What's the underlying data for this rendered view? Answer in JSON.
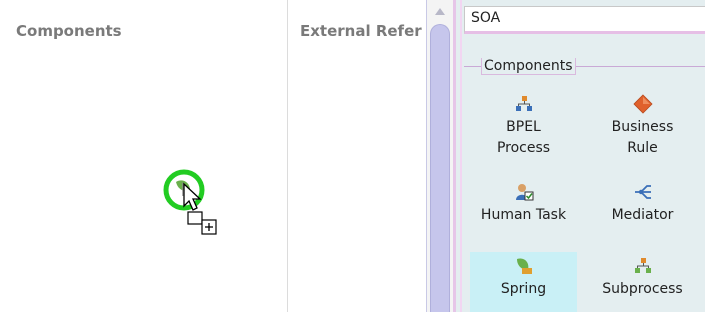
{
  "canvas": {
    "components_title": "Components",
    "external_refs_title": "External Refer"
  },
  "palette": {
    "selected_category": "SOA",
    "section_label": "Components",
    "items": [
      {
        "label_line1": "BPEL",
        "label_line2": "Process",
        "icon": "bpel-process-icon"
      },
      {
        "label_line1": "Business",
        "label_line2": "Rule",
        "icon": "business-rule-icon"
      },
      {
        "label_line1": "Human Task",
        "label_line2": "",
        "icon": "human-task-icon"
      },
      {
        "label_line1": "Mediator",
        "label_line2": "",
        "icon": "mediator-icon"
      },
      {
        "label_line1": "Spring",
        "label_line2": "",
        "icon": "spring-icon"
      },
      {
        "label_line1": "Subprocess",
        "label_line2": "",
        "icon": "subprocess-icon"
      }
    ]
  },
  "colors": {
    "selected_item_bg": "#c9f0f6",
    "drag_highlight": "#22cc22",
    "palette_bg": "#e4eef0"
  }
}
